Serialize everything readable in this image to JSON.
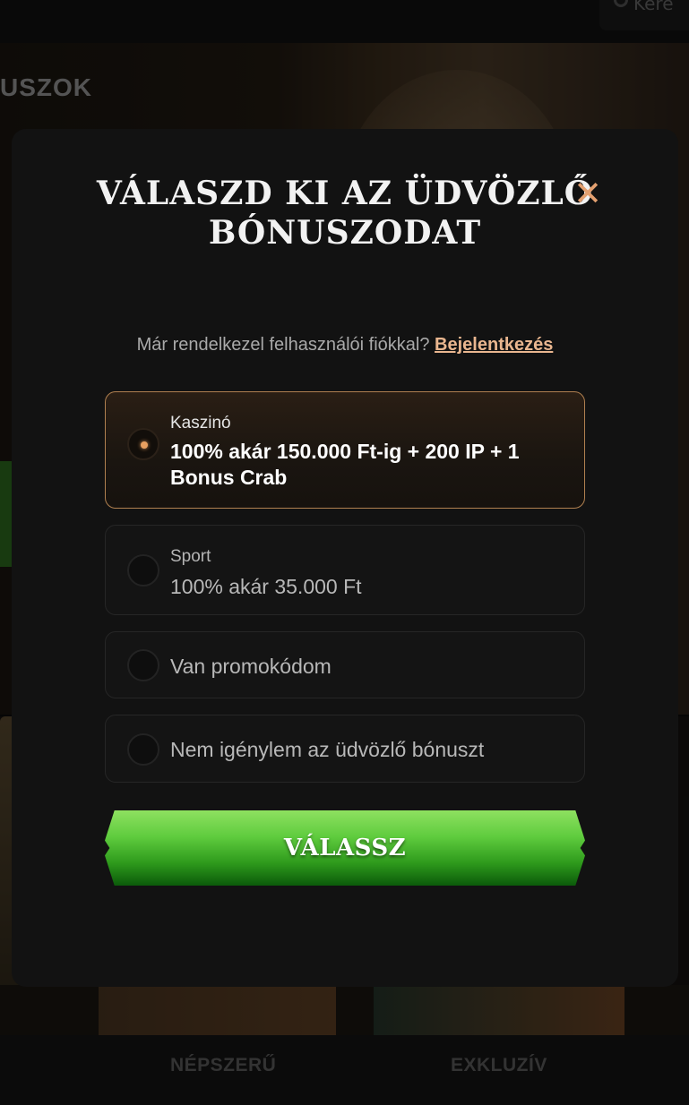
{
  "header": {
    "search_placeholder": "Kere"
  },
  "background": {
    "section_label": "USZOK"
  },
  "bottom_nav": {
    "items": [
      "NÉPSZERŰ",
      "EXKLUZÍV"
    ]
  },
  "modal": {
    "title": "VÁLASZD KI AZ ÜDVÖZLŐ BÓNUSZODAT",
    "close_icon": "close-icon",
    "login_prompt": "Már rendelkezel felhasználói fiókkal?",
    "login_link": "Bejelentkezés",
    "options": [
      {
        "label": "Kaszinó",
        "value": "100% akár 150.000 Ft-ig + 200 IP + 1 Bonus Crab",
        "selected": true
      },
      {
        "label": "Sport",
        "value": "100% akár 35.000 Ft",
        "selected": false
      },
      {
        "label": "",
        "value": "Van promokódom",
        "selected": false
      },
      {
        "label": "",
        "value": "Nem igénylem az üdvözlő bónuszt",
        "selected": false
      }
    ],
    "submit_label": "VÁLASSZ"
  },
  "colors": {
    "accent": "#e3a070",
    "link": "#e9b68f",
    "button_green": "#5fcc3e",
    "selected_border": "#b08050",
    "modal_bg": "#121212"
  }
}
